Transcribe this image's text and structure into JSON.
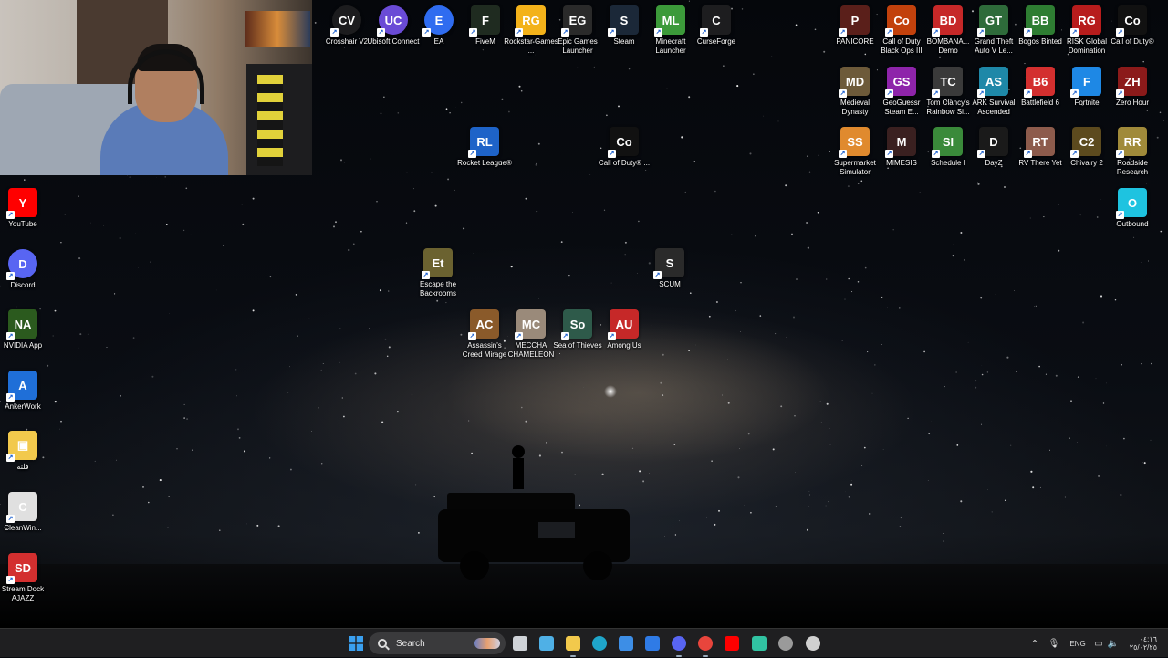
{
  "desktop_icons": {
    "top_row": [
      {
        "label": "Crosshair V2",
        "icon": "crosshair-icon",
        "color": "#1c1c1e"
      },
      {
        "label": "Ubisoft Connect",
        "icon": "ubisoft-swirl-icon",
        "color": "#6a4bd6"
      },
      {
        "label": "EA",
        "icon": "ea-logo-icon",
        "color": "#2f6cf0"
      },
      {
        "label": "FiveM",
        "icon": "fivem-logo-icon",
        "color": "#1f2b20"
      },
      {
        "label": "Rockstar Games ...",
        "icon": "rockstar-logo-icon",
        "color": "#f3b21a"
      },
      {
        "label": "Epic Games Launcher",
        "icon": "epic-logo-icon",
        "color": "#2a2a2a"
      },
      {
        "label": "Steam",
        "icon": "steam-logo-icon",
        "color": "#1b2838"
      },
      {
        "label": "Minecraft Launcher",
        "icon": "minecraft-creeper-icon",
        "color": "#3c9a3a"
      },
      {
        "label": "CurseForge",
        "icon": "curseforge-anvil-icon",
        "color": "#1d1d1f"
      }
    ],
    "right_grid": [
      {
        "label": "PANICORE",
        "icon": "panicore-icon",
        "color": "#5a1f1a"
      },
      {
        "label": "Call of Duty Black Ops III",
        "icon": "black-ops-icon",
        "color": "#c2410c"
      },
      {
        "label": "BOMBANA... Demo",
        "icon": "bombana-car-icon",
        "color": "#c62828"
      },
      {
        "label": "Grand Theft Auto V Le...",
        "icon": "gta-icon",
        "color": "#2e6b3a"
      },
      {
        "label": "Bogos Binted",
        "icon": "alien-icon",
        "color": "#2e7d32"
      },
      {
        "label": "RISK Global Domination",
        "icon": "risk-logo-icon",
        "color": "#b71c1c"
      },
      {
        "label": "Call of Duty®",
        "icon": "cod-logo-icon",
        "color": "#111111"
      },
      {
        "label": "Medieval Dynasty",
        "icon": "medieval-icon",
        "color": "#6d5a3a"
      },
      {
        "label": "GeoGuessr Steam E...",
        "icon": "geoguessr-pin-icon",
        "color": "#8e24aa"
      },
      {
        "label": "Tom Clancy's Rainbow Si...",
        "icon": "rainbow-six-icon",
        "color": "#3a3a3a"
      },
      {
        "label": "ARK Survival Ascended",
        "icon": "ark-icon",
        "color": "#1e88a8"
      },
      {
        "label": "Battlefield 6",
        "icon": "battlefield-icon",
        "color": "#d32f2f"
      },
      {
        "label": "Fortnite",
        "icon": "fortnite-icon",
        "color": "#1e88e5"
      },
      {
        "label": "Zero Hour",
        "icon": "zero-hour-icon",
        "color": "#8b1a1a"
      },
      {
        "label": "Supermarket Simulator",
        "icon": "supermarket-icon",
        "color": "#e08a2e"
      },
      {
        "label": "MIMESIS",
        "icon": "mimesis-icon",
        "color": "#3a2020"
      },
      {
        "label": "Schedule I",
        "icon": "schedule-leaf-icon",
        "color": "#3a8a3a"
      },
      {
        "label": "DayZ",
        "icon": "dayz-icon",
        "color": "#1a1a1a"
      },
      {
        "label": "RV There Yet",
        "icon": "rv-icon",
        "color": "#8d5b4c"
      },
      {
        "label": "Chivalry 2",
        "icon": "chivalry-shield-icon",
        "color": "#5c4a1e"
      },
      {
        "label": "Roadside Research",
        "icon": "roadside-icon",
        "color": "#a08a3a"
      },
      {
        "label": "Outbound",
        "icon": "outbound-icon",
        "color": "#1ec3e0"
      }
    ],
    "left_column": [
      {
        "label": "YouTube",
        "icon": "youtube-icon",
        "color": "#ff0000"
      },
      {
        "label": "Discord",
        "icon": "discord-icon",
        "color": "#5865f2"
      },
      {
        "label": "NVIDIA App",
        "icon": "nvidia-icon",
        "color": "#2b5a1e"
      },
      {
        "label": "AnkerWork",
        "icon": "ankerwork-icon",
        "color": "#1f6fd8"
      },
      {
        "label": "فلته",
        "icon": "folder-icon",
        "color": "#f2c94c"
      },
      {
        "label": "CleanWin...",
        "icon": "cleanwin-gear-icon",
        "color": "#e0e0e0"
      },
      {
        "label": "Stream Dock AJAZZ",
        "icon": "stream-dock-icon",
        "color": "#d32f2f"
      }
    ],
    "center": [
      {
        "label": "Rocket League®",
        "icon": "rocket-league-icon",
        "color": "#1e63c8"
      },
      {
        "label": "Call of Duty® ...",
        "icon": "cod-logo-icon",
        "color": "#111111"
      },
      {
        "label": "Escape the Backrooms",
        "icon": "backrooms-icon",
        "color": "#6b6230"
      },
      {
        "label": "SCUM",
        "icon": "scum-icon",
        "color": "#2a2a2a"
      },
      {
        "label": "Assassin's Creed Mirage",
        "icon": "assassins-creed-icon",
        "color": "#8a5a2a"
      },
      {
        "label": "MECCHA CHAMELEON",
        "icon": "chameleon-icon",
        "color": "#9a8a7a"
      },
      {
        "label": "Sea of Thieves",
        "icon": "sea-of-thieves-icon",
        "color": "#2e5a4a"
      },
      {
        "label": "Among Us",
        "icon": "among-us-icon",
        "color": "#c62828"
      }
    ]
  },
  "taskbar": {
    "search_placeholder": "Search",
    "pinned": [
      {
        "name": "taskview",
        "icon": "task-view-icon",
        "color": "#cfd3d8"
      },
      {
        "name": "copilot",
        "icon": "copilot-icon",
        "color": "#4fb0e6"
      },
      {
        "name": "file-explorer",
        "icon": "folder-icon",
        "color": "#f2c94c"
      },
      {
        "name": "edge",
        "icon": "edge-icon",
        "color": "#1fa5c9"
      },
      {
        "name": "store",
        "icon": "store-icon",
        "color": "#3d8ee6"
      },
      {
        "name": "mail",
        "icon": "mail-icon",
        "color": "#2f7be6"
      },
      {
        "name": "discord",
        "icon": "discord-icon",
        "color": "#5865f2"
      },
      {
        "name": "chrome",
        "icon": "chrome-icon",
        "color": "#e8453c"
      },
      {
        "name": "youtube",
        "icon": "youtube-icon",
        "color": "#ff0000"
      },
      {
        "name": "streamlabs",
        "icon": "streamlabs-icon",
        "color": "#31c3a2"
      },
      {
        "name": "obs",
        "icon": "obs-icon",
        "color": "#9a9a9a"
      },
      {
        "name": "settings",
        "icon": "gear-icon",
        "color": "#d0d0d0"
      }
    ],
    "tray": {
      "language": "ENG",
      "time": "٠٤:١٦",
      "date": "٢٥/٠٢/٢٥"
    }
  },
  "colors": {
    "taskbar_bg": "#202022",
    "start_blue": "#2b8ae6"
  }
}
